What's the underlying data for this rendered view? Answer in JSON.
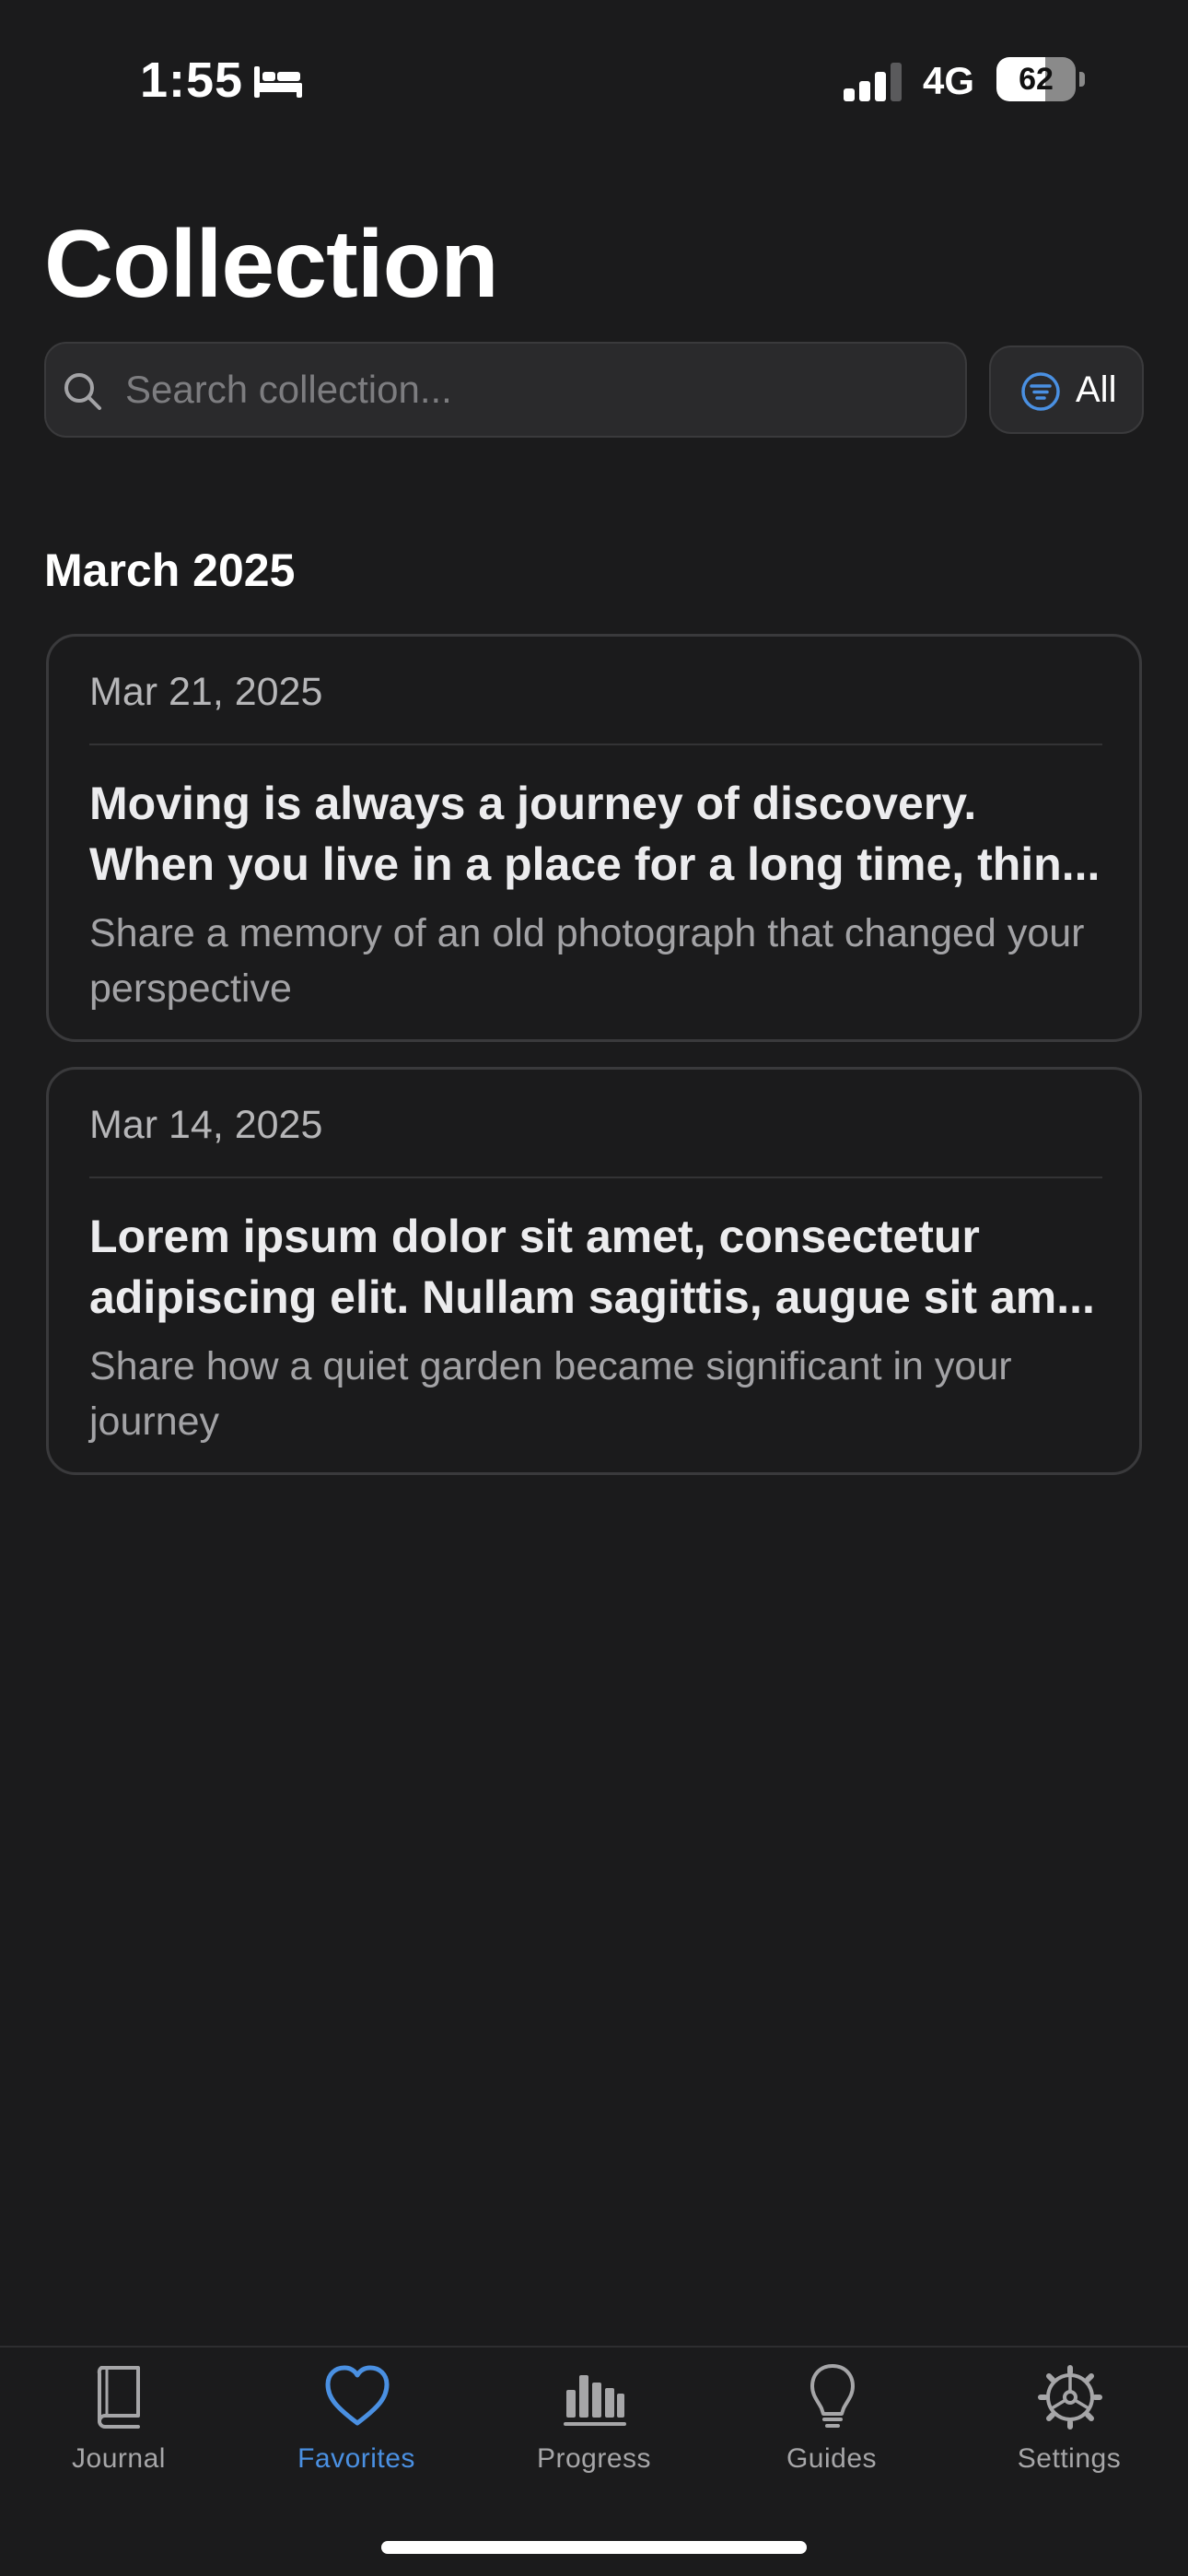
{
  "status_bar": {
    "time": "1:55",
    "network": "4G",
    "battery": "62",
    "battery_level": 0.62
  },
  "page": {
    "title": "Collection"
  },
  "search": {
    "placeholder": "Search collection...",
    "value": ""
  },
  "filter": {
    "label": "All"
  },
  "sections": [
    {
      "title": "March 2025",
      "entries": [
        {
          "date": "Mar 21, 2025",
          "title_lines": [
            "Moving is always a journey of discovery.",
            "When you live in a place for a long time, thin..."
          ],
          "prompt": "Share a memory of an old photograph that changed your perspective"
        },
        {
          "date": "Mar 14, 2025",
          "title_lines": [
            "Lorem ipsum dolor sit amet, consectetur",
            "adipiscing elit. Nullam sagittis, augue sit am..."
          ],
          "prompt": "Share how a quiet garden became significant in your journey"
        }
      ]
    }
  ],
  "tab_bar": {
    "items": [
      {
        "label": "Journal",
        "icon": "book-icon"
      },
      {
        "label": "Favorites",
        "icon": "heart-icon",
        "active": true
      },
      {
        "label": "Progress",
        "icon": "bar-chart-icon"
      },
      {
        "label": "Guides",
        "icon": "lightbulb-icon"
      },
      {
        "label": "Settings",
        "icon": "gear-icon"
      }
    ]
  },
  "colors": {
    "background": "#1b1b1c",
    "accent": "#4a90e2",
    "card_border": "#3a3a3c",
    "muted_text": "#a3a3a6"
  }
}
